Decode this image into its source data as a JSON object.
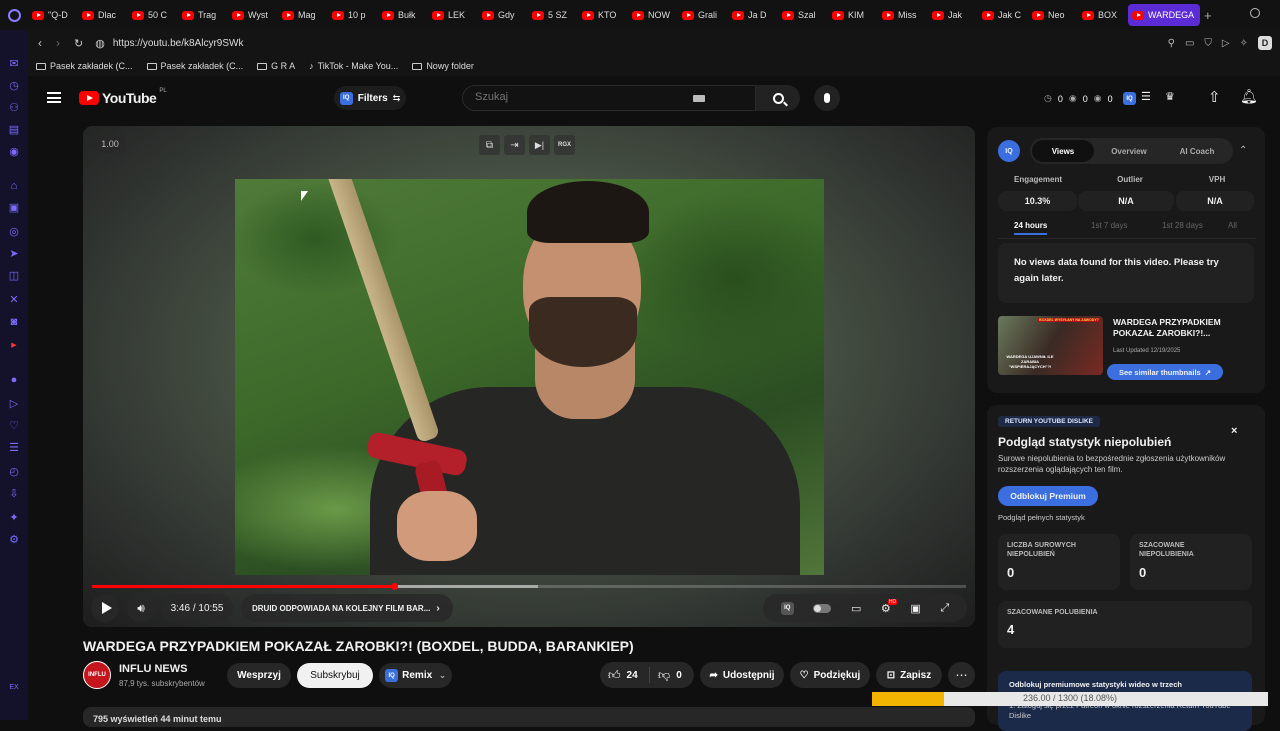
{
  "tabs": [
    "\"Q-D",
    "Dlac",
    "50 C",
    "Trag",
    "Wyst",
    "Mag",
    "10 p",
    "Bułk",
    "LEK",
    "Gdy",
    "5 SZ",
    "KTO",
    "NOW",
    "Grali",
    "Ja D",
    "Szal",
    "KIM",
    "Miss",
    "Jak",
    "Jak C",
    "Neo",
    "BOX"
  ],
  "active_tab": "WARDEGA",
  "address": "https://youtu.be/k8Alcyr9SWk",
  "bookmarks": [
    "Pasek zakładek (C...",
    "Pasek zakładek (C...",
    "G R A",
    "TikTok - Make You...",
    "Nowy folder"
  ],
  "profile_initial": "D",
  "header": {
    "logo": "YouTube",
    "country": "PL",
    "filters": "Filters",
    "search_placeholder": "Szukaj",
    "counters": [
      "0",
      "0",
      "0"
    ]
  },
  "player": {
    "speed": "1.00",
    "top_rgx": "RGX",
    "time": "3:46 / 10:55",
    "chapter": "DRUID ODPOWIADA NA KOLEJNY FILM BAR...",
    "progress": 0.345,
    "buffer": 0.51,
    "hd": "HD"
  },
  "video": {
    "title": "WARDEGA PRZYPADKIEM POKAZAŁ ZAROBKI?! (BOXDEL, BUDDA, BARANKIEP)",
    "channel": "INFLU NEWS",
    "channel_logo_text": "INFLU",
    "subs": "87,9 tys. subskrybentów",
    "join": "Wesprzyj",
    "subscribe": "Subskrybuj",
    "remix": "Remix",
    "likes": "24",
    "dislikes": "0",
    "share": "Udostępnij",
    "thanks": "Podziękuj",
    "save": "Zapisz",
    "views_stub": "795 wyświetleń  44 minut temu"
  },
  "iq_panel": {
    "badge": "IQ",
    "tabs": [
      "Views",
      "Overview",
      "AI Coach"
    ],
    "metrics": [
      {
        "label": "Engagement",
        "value": "10.3%"
      },
      {
        "label": "Outlier",
        "value": "N/A"
      },
      {
        "label": "VPH",
        "value": "N/A"
      }
    ],
    "periods": [
      "24 hours",
      "1st 7 days",
      "1st 28 days",
      "All"
    ],
    "no_data": "No views data found for this video. Please try again later.",
    "thumb_title": "WARDEGA PRZYPADKIEM POKAZAŁ ZAROBKI?!...",
    "last_updated": "Last Updated 12/19/2025",
    "similar": "See similar thumbnails",
    "thumb_text_top": "BOXDEL WYSYŁANY NA ZAWODY?",
    "thumb_text_bottom": "WARDEGA UJAWNIŁ ILE ZARABIA \"WSPIERAJĄCYCH\"?!"
  },
  "ryd": {
    "badge": "RETURN YOUTUBE DISLIKE",
    "title": "Podgląd statystyk niepolubień",
    "desc": "Surowe niepolubienia to bezpośrednie zgłoszenia użytkowników rozszerzenia oglądających ten film.",
    "premium_btn": "Odblokuj Premium",
    "full_stats": "Podgląd pełnych statystyk",
    "raw_label": "LICZBA SUROWYCH NIEPOLUBIEŃ",
    "raw_value": "0",
    "est_label": "SZACOWANE NIEPOLUBIENIA",
    "est_value": "0",
    "likes_label": "SZACOWANE POLUBIENIA",
    "likes_value": "4",
    "premium_note": "Odblokuj premiumowe statystyki wideo w trzech",
    "step1": "1. Zaloguj się przez Patreon w oknie rozszerzenia Return YouTube Dislike",
    "download_progress": "236.00 / 1300 (18.08%)",
    "download_fraction": 0.1808
  },
  "colors": {
    "accent": "#3b6fe0",
    "red": "#ff0000",
    "purple": "#5b2bd6",
    "gold": "#f2b400"
  }
}
